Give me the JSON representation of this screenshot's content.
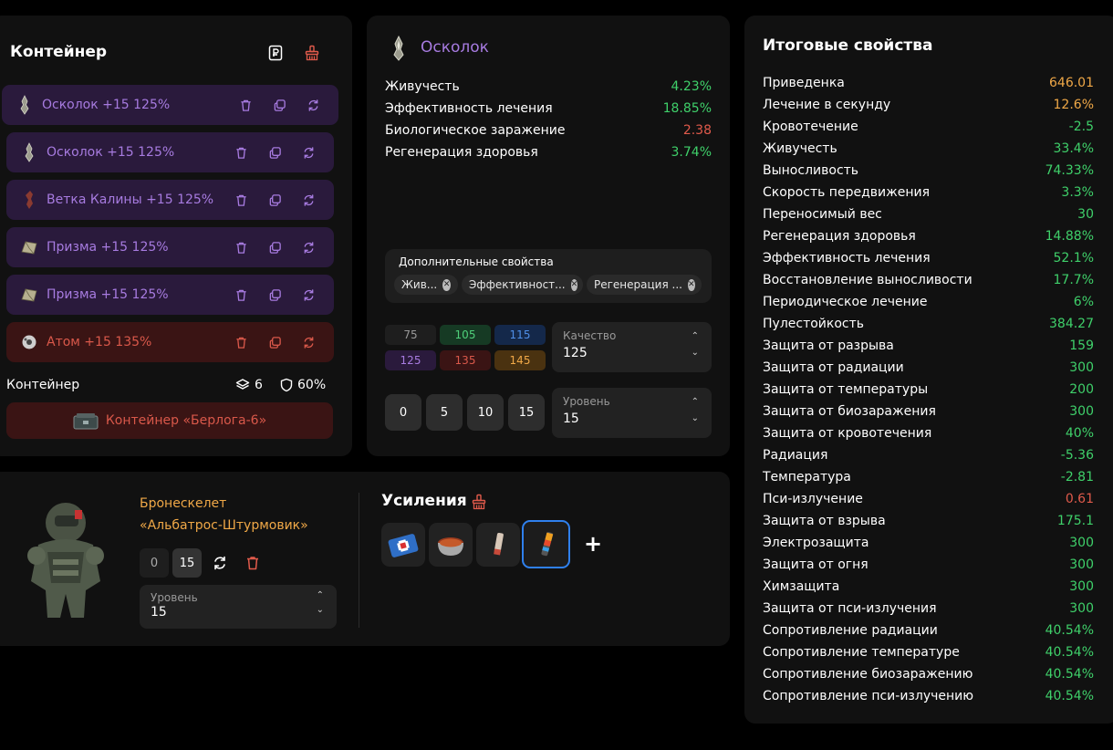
{
  "container": {
    "title": "Контейнер",
    "items": [
      {
        "label": "Осколок +15 125%",
        "variant": "purple",
        "icon": "shard-icon"
      },
      {
        "label": "Осколок +15 125%",
        "variant": "purple",
        "icon": "shard-icon"
      },
      {
        "label": "Ветка Калины +15 125%",
        "variant": "purple",
        "icon": "branch-icon"
      },
      {
        "label": "Призма +15 125%",
        "variant": "purple",
        "icon": "prism-icon"
      },
      {
        "label": "Призма +15 125%",
        "variant": "purple",
        "icon": "prism-icon"
      },
      {
        "label": "Атом +15 135%",
        "variant": "red",
        "icon": "atom-icon"
      }
    ],
    "footer_label": "Контейнер",
    "slots": "6",
    "protection": "60%",
    "container_name": "Контейнер «Берлога-6»"
  },
  "details": {
    "title": "Осколок",
    "stats": [
      {
        "name": "Живучесть",
        "value": "4.23%",
        "tone": "green"
      },
      {
        "name": "Эффективность лечения",
        "value": "18.85%",
        "tone": "green"
      },
      {
        "name": "Биологическое заражение",
        "value": "2.38",
        "tone": "red"
      },
      {
        "name": "Регенерация здоровья",
        "value": "3.74%",
        "tone": "green"
      }
    ],
    "extra_title": "Дополнительные свойства",
    "extra_chips": [
      "Жив...",
      "Эффективност...",
      "Регенерация ..."
    ],
    "quality_buttons": [
      "75",
      "105",
      "115",
      "125",
      "135",
      "145"
    ],
    "quality_label": "Качество",
    "quality_value": "125",
    "level_buttons": [
      "0",
      "5",
      "10",
      "15"
    ],
    "level_label": "Уровень",
    "level_value": "15"
  },
  "final": {
    "title": "Итоговые свойства",
    "stats": [
      {
        "name": "Приведенка",
        "value": "646.01",
        "tone": "orange"
      },
      {
        "name": "Лечение в секунду",
        "value": "12.6%",
        "tone": "orange"
      },
      {
        "name": "Кровотечение",
        "value": "-2.5",
        "tone": "green"
      },
      {
        "name": "Живучесть",
        "value": "33.4%",
        "tone": "green"
      },
      {
        "name": "Выносливость",
        "value": "74.33%",
        "tone": "green"
      },
      {
        "name": "Скорость передвижения",
        "value": "3.3%",
        "tone": "green"
      },
      {
        "name": "Переносимый вес",
        "value": "30",
        "tone": "green"
      },
      {
        "name": "Регенерация здоровья",
        "value": "14.88%",
        "tone": "green"
      },
      {
        "name": "Эффективность лечения",
        "value": "52.1%",
        "tone": "green"
      },
      {
        "name": "Восстановление выносливости",
        "value": "17.7%",
        "tone": "green"
      },
      {
        "name": "Периодическое лечение",
        "value": "6%",
        "tone": "green"
      },
      {
        "name": "Пулестойкость",
        "value": "384.27",
        "tone": "green"
      },
      {
        "name": "Защита от разрыва",
        "value": "159",
        "tone": "green"
      },
      {
        "name": "Защита от радиации",
        "value": "300",
        "tone": "green"
      },
      {
        "name": "Защита от температуры",
        "value": "200",
        "tone": "green"
      },
      {
        "name": "Защита от биозаражения",
        "value": "300",
        "tone": "green"
      },
      {
        "name": "Защита от кровотечения",
        "value": "40%",
        "tone": "green"
      },
      {
        "name": "Радиация",
        "value": "-5.36",
        "tone": "green"
      },
      {
        "name": "Температура",
        "value": "-2.81",
        "tone": "green"
      },
      {
        "name": "Пси-излучение",
        "value": "0.61",
        "tone": "red"
      },
      {
        "name": "Защита от взрыва",
        "value": "175.1",
        "tone": "green"
      },
      {
        "name": "Электрозащита",
        "value": "300",
        "tone": "green"
      },
      {
        "name": "Защита от огня",
        "value": "300",
        "tone": "green"
      },
      {
        "name": "Химзащита",
        "value": "300",
        "tone": "green"
      },
      {
        "name": "Защита от пси-излучения",
        "value": "300",
        "tone": "green"
      },
      {
        "name": "Сопротивление радиации",
        "value": "40.54%",
        "tone": "green"
      },
      {
        "name": "Сопротивление температуре",
        "value": "40.54%",
        "tone": "green"
      },
      {
        "name": "Сопротивление биозаражению",
        "value": "40.54%",
        "tone": "green"
      },
      {
        "name": "Сопротивление пси-излучению",
        "value": "40.54%",
        "tone": "green"
      }
    ]
  },
  "armor": {
    "name_line1": "Бронескелет",
    "name_line2": "«Альбатрос-Штурмовик»",
    "level_buttons": [
      "0",
      "15"
    ],
    "level_label": "Уровень",
    "level_value": "15",
    "boosts_title": "Усиления",
    "add_symbol": "+"
  },
  "colors": {
    "purple_row": "#2a1a3c",
    "red_row": "#3a1414",
    "accent_green": "#3fd06a",
    "accent_orange": "#f0a847",
    "accent_red": "#e05a4b"
  }
}
